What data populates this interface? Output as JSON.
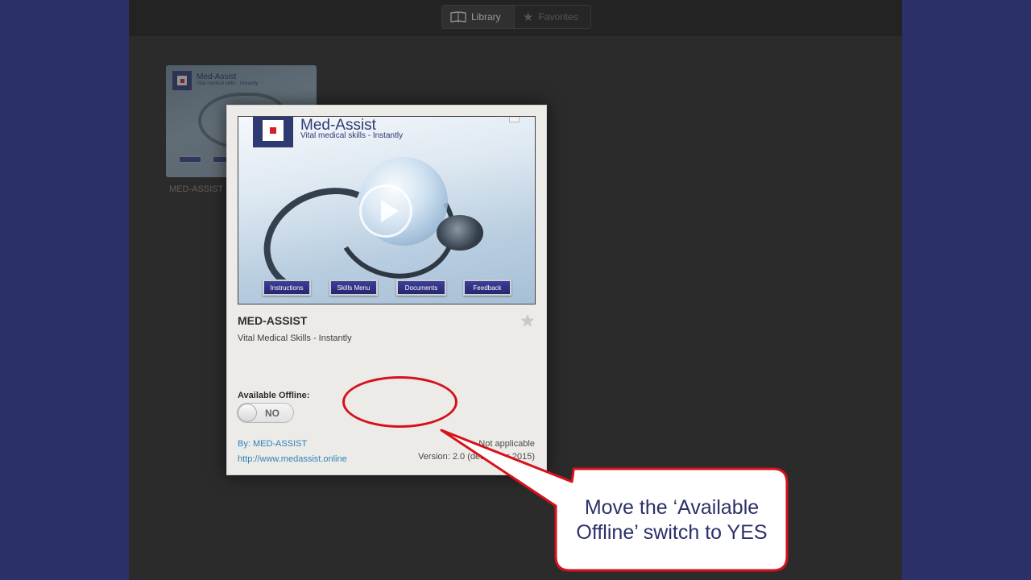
{
  "topbar": {
    "library_label": "Library",
    "favorites_label": "Favorites"
  },
  "library": {
    "items": [
      {
        "label": "MED-ASSIST",
        "thumbnail_title": "Med-Assist",
        "thumbnail_subtitle": "Vital medical skills · Instantly"
      }
    ]
  },
  "modal": {
    "hero": {
      "title": "Med-Assist",
      "subtitle": "Vital medical skills - Instantly",
      "buttons": [
        "Instructions",
        "Skills Menu",
        "Documents",
        "Feedback"
      ]
    },
    "app_name": "MED-ASSIST",
    "tagline": "Vital Medical Skills - Instantly",
    "offline_label": "Available Offline:",
    "offline_state": "NO",
    "by": "By: MED-ASSIST",
    "url": "http://www.medassist.online",
    "applicable": "Not applicable",
    "version": "Version: 2.0 (december 2015)"
  },
  "callout": {
    "text": "Move the ‘Available Offline’ switch to YES",
    "color": "#d7111c"
  },
  "colors": {
    "brand_navy": "#2c3068",
    "link_blue": "#2f83b8",
    "accent_red": "#d7111c"
  }
}
